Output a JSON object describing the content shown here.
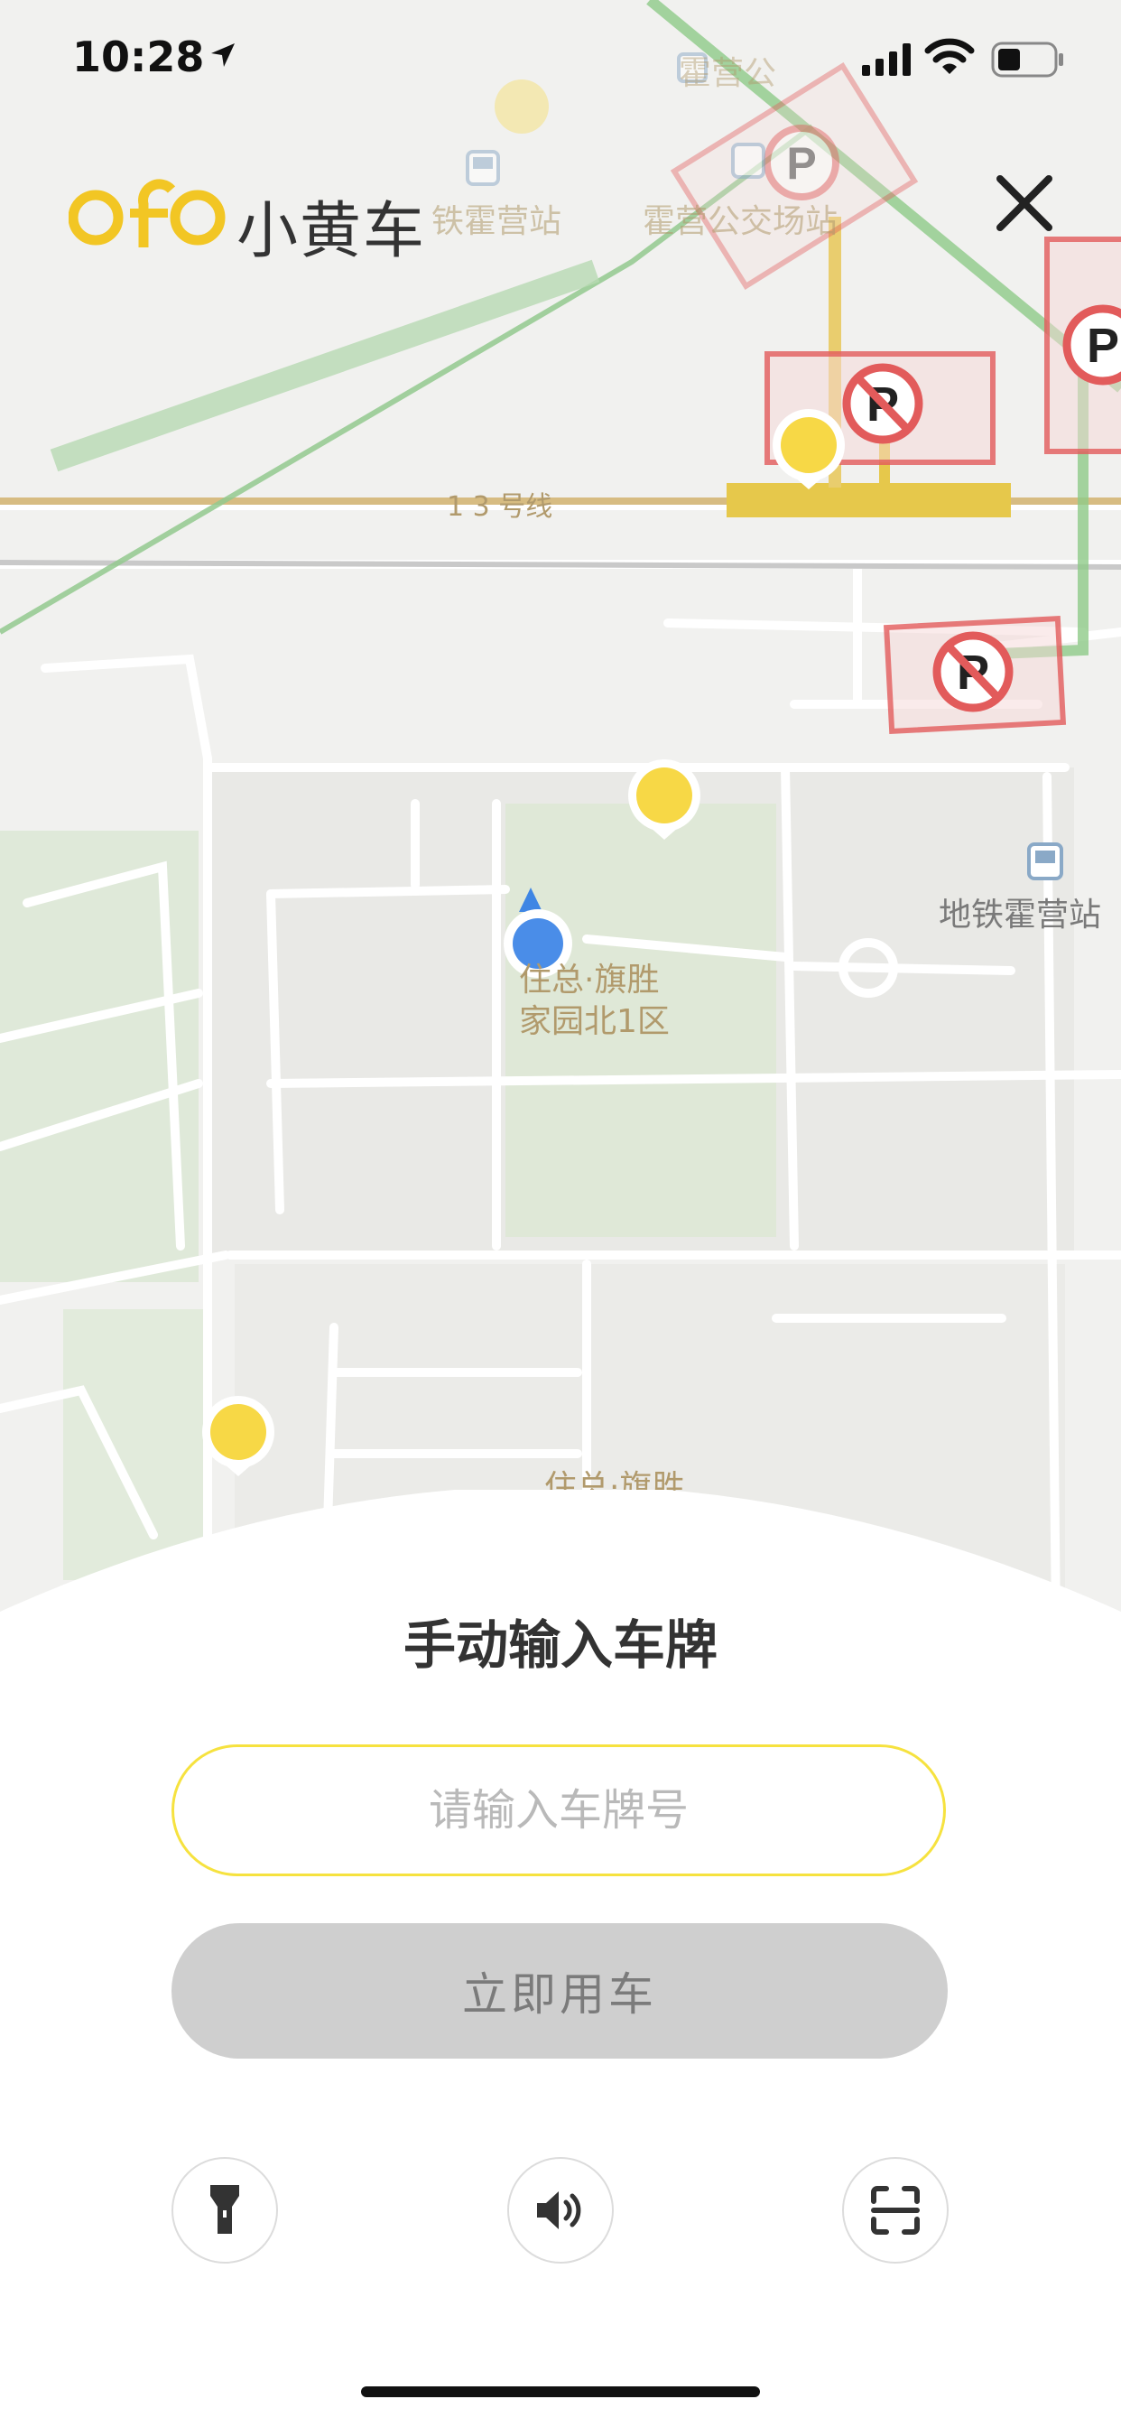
{
  "status_bar": {
    "time": "10:28"
  },
  "header": {
    "logo_text": "ofo",
    "brand_cn": "小黄车"
  },
  "map": {
    "labels": {
      "subway_top": "霍营公",
      "station_left": "铁霍营站",
      "station_bus": "霍营公交场站",
      "line13": "1 3 号线",
      "community": "住总·旗胜",
      "community_2": "家园北1区",
      "subway_right": "地铁霍营站",
      "bottom_community": "住总·旗胜"
    },
    "colors": {
      "bike_pin": "#f7d846",
      "user_dot": "#4a8de8",
      "no_parking": "#e25b5b"
    }
  },
  "sheet": {
    "title": "手动输入车牌",
    "input_placeholder": "请输入车牌号",
    "button": "立即用车"
  },
  "actions": [
    {
      "icon": "flashlight-icon"
    },
    {
      "icon": "speaker-icon"
    },
    {
      "icon": "scan-icon"
    }
  ]
}
